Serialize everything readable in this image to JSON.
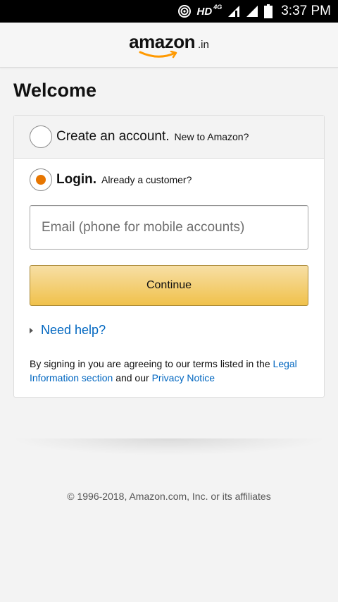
{
  "status_bar": {
    "network_label": "HD",
    "network_type": "4G",
    "time": "3:37 PM",
    "icons": [
      "hotspot-icon",
      "signal-icon",
      "signal-icon",
      "battery-icon"
    ]
  },
  "header": {
    "logo_text": "amazon",
    "logo_tld": ".in",
    "accent_color": "#ff9900"
  },
  "page": {
    "title": "Welcome"
  },
  "create_option": {
    "label": "Create an account.",
    "sub": "New to Amazon?",
    "selected": false
  },
  "login_option": {
    "label": "Login.",
    "sub": "Already a customer?",
    "selected": true
  },
  "email": {
    "placeholder": "Email (phone for mobile accounts)",
    "value": ""
  },
  "continue_button": {
    "label": "Continue"
  },
  "help": {
    "label": "Need help?"
  },
  "legal": {
    "prefix": "By signing in you are agreeing to our terms listed in the",
    "legal_link": "Legal Information section",
    "middle": "and our",
    "privacy_link": "Privacy Notice"
  },
  "footer": {
    "copyright": "© 1996-2018, Amazon.com, Inc. or its affiliates"
  },
  "colors": {
    "link": "#0066c0",
    "radio_selected": "#e77600",
    "button_top": "#f7dfa5",
    "button_bottom": "#f0c14b"
  }
}
